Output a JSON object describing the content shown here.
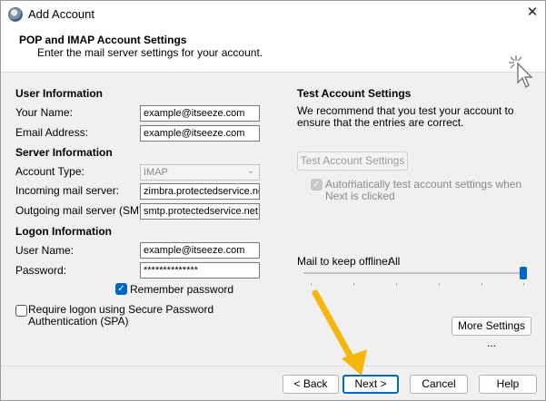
{
  "window": {
    "title": "Add Account",
    "close_glyph": "✕"
  },
  "header": {
    "title": "POP and IMAP Account Settings",
    "subtitle": "Enter the mail server settings for your account.",
    "icon": "wand-cursor-icon"
  },
  "user_info": {
    "section": "User Information",
    "name_label": "Your Name:",
    "name_value": "example@itseeze.com",
    "email_label": "Email Address:",
    "email_value": "example@itseeze.com"
  },
  "server_info": {
    "section": "Server Information",
    "account_type_label": "Account Type:",
    "account_type_value": "IMAP",
    "incoming_label": "Incoming mail server:",
    "incoming_value": "zimbra.protectedservice.net",
    "outgoing_label": "Outgoing mail server (SMTP):",
    "outgoing_value": "smtp.protectedservice.net"
  },
  "logon_info": {
    "section": "Logon Information",
    "username_label": "User Name:",
    "username_value": "example@itseeze.com",
    "password_label": "Password:",
    "password_value": "**************",
    "remember_label": "Remember password",
    "remember_checked": true,
    "spa_label": "Require logon using Secure Password Authentication (SPA)",
    "spa_checked": false
  },
  "test": {
    "section": "Test Account Settings",
    "description": "We recommend that you test your account to ensure that the entries are correct.",
    "button": "Test Account Settings ...",
    "auto_label": "Automatically test account settings when Next is clicked",
    "auto_checked": true
  },
  "offline": {
    "label": "Mail to keep offline:",
    "value": "All",
    "slider_level": 1.0
  },
  "buttons": {
    "more_settings": "More Settings ...",
    "back": "< Back",
    "next": "Next >",
    "cancel": "Cancel",
    "help": "Help"
  },
  "colors": {
    "accent": "#0067c0",
    "annotation_arrow": "#f5b70f"
  }
}
